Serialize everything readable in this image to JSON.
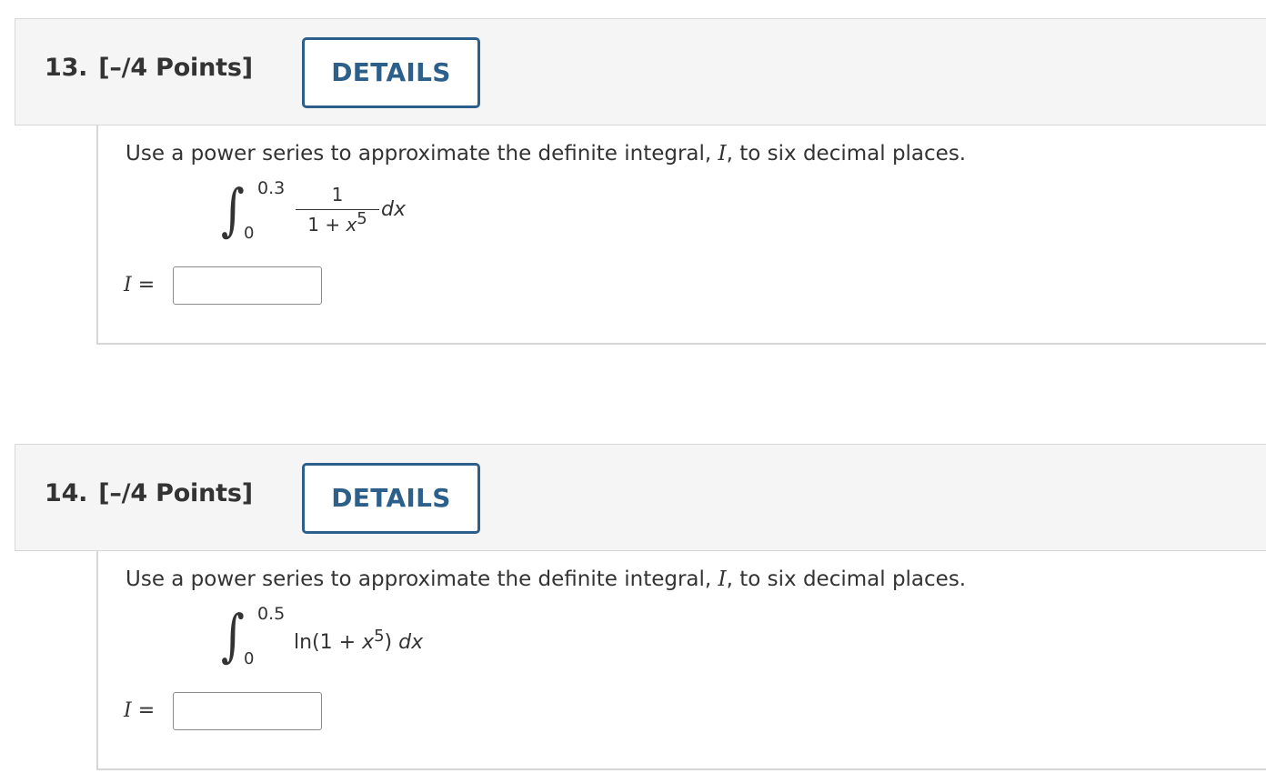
{
  "questions": [
    {
      "number": "13.",
      "points": "[–/4 Points]",
      "details_label": "DETAILS",
      "prompt_before": "Use a power series to approximate the definite integral, ",
      "prompt_var": "I",
      "prompt_after": ", to six decimal places.",
      "integral": {
        "upper": "0.3",
        "lower": "0",
        "numerator": "1",
        "denominator_base": "1 + ",
        "denominator_var": "x",
        "denominator_exp": "5",
        "differential": "dx"
      },
      "answer_var": "I",
      "answer_eq": " =",
      "answer_value": ""
    },
    {
      "number": "14.",
      "points": "[–/4 Points]",
      "details_label": "DETAILS",
      "prompt_before": "Use a power series to approximate the definite integral, ",
      "prompt_var": "I",
      "prompt_after": ", to six decimal places.",
      "integral": {
        "upper": "0.5",
        "lower": "0",
        "expr_prefix": "ln(1 + ",
        "expr_var": "x",
        "expr_exp": "5",
        "expr_suffix": ")",
        "differential": "dx"
      },
      "answer_var": "I",
      "answer_eq": " =",
      "answer_value": ""
    }
  ],
  "colors": {
    "header_bg": "#f5f5f5",
    "accent": "#2d5f8b",
    "text": "#333333",
    "border": "#d7d7d7"
  }
}
